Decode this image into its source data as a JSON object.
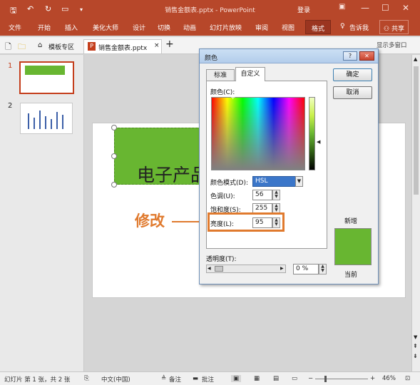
{
  "window": {
    "title": "销售金额表.pptx - PowerPoint",
    "login": "登录"
  },
  "ribbon": {
    "tabs": [
      "文件",
      "开始",
      "插入",
      "美化大师",
      "设计",
      "切换",
      "动画",
      "幻灯片放映",
      "审阅",
      "视图",
      "格式"
    ],
    "active_tab": "格式",
    "tell_me": "告诉我",
    "share": "共享"
  },
  "doc_tabs": {
    "items": [
      "模板专区",
      "销售金额表.pptx"
    ],
    "active": "销售金额表.pptx",
    "multi_window": "显示多窗口"
  },
  "slides": {
    "numbers": [
      "1",
      "2"
    ]
  },
  "slide": {
    "text": "电子产品",
    "annotation": "修改"
  },
  "dialog": {
    "title": "颜色",
    "help": "?",
    "tabs": [
      "标准",
      "自定义"
    ],
    "active_tab": "自定义",
    "ok_label": "确定",
    "cancel_label": "取消",
    "colors_label": "颜色(C):",
    "color_model_label": "颜色模式(D):",
    "color_model_value": "HSL",
    "hue_label": "色调(U):",
    "hue_value": "56",
    "sat_label": "饱和度(S):",
    "sat_value": "255",
    "lum_label": "亮度(L):",
    "lum_value": "95",
    "new_label": "新增",
    "current_label": "当前",
    "transparency_label": "透明度(T):",
    "transparency_value": "0 %",
    "new_color": "#68b631",
    "current_color": "#68b631"
  },
  "statusbar": {
    "slide_info": "幻灯片 第 1 张，共 2 张",
    "language": "中文(中国)",
    "notes": "备注",
    "comments": "批注",
    "zoom": "46%"
  },
  "colors": {
    "brand": "#b7472a",
    "accent": "#68b631",
    "annotation": "#e07a2e"
  }
}
